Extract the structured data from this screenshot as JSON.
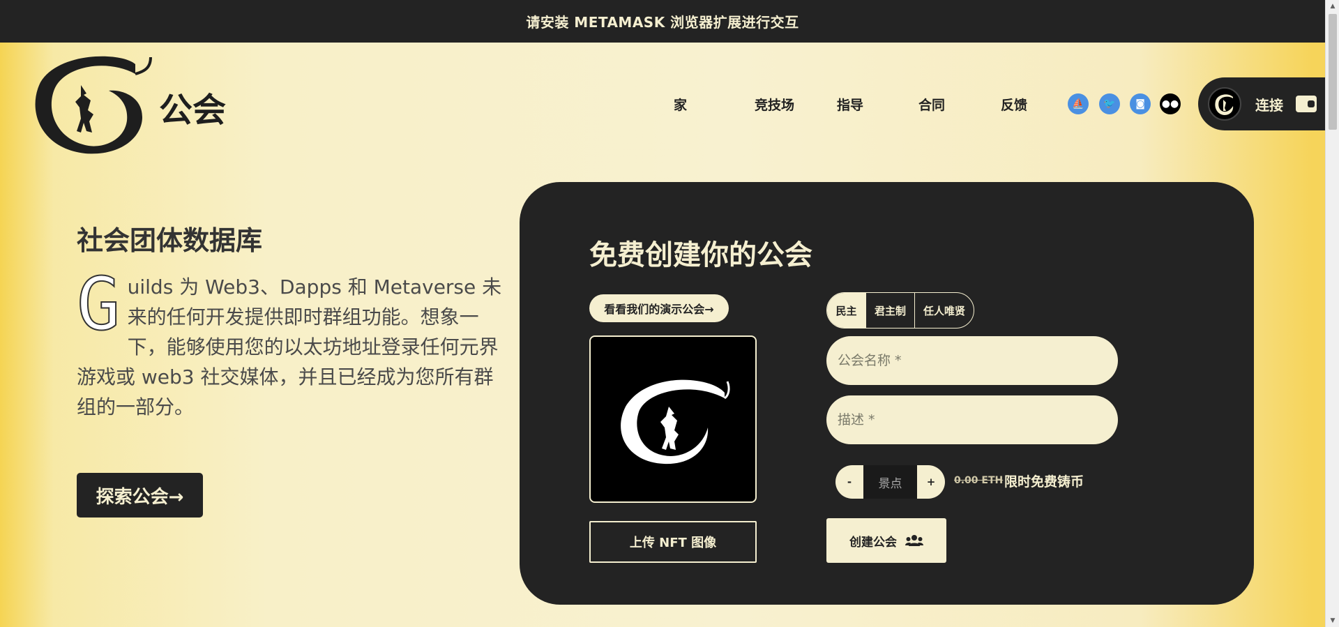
{
  "banner": {
    "text": "请安装 METAMASK 浏览器扩展进行交互"
  },
  "brand": {
    "name": "公会"
  },
  "nav": {
    "items": [
      {
        "label": "家"
      },
      {
        "label": "竞技场"
      },
      {
        "label": "指导"
      },
      {
        "label": "合同"
      },
      {
        "label": "反馈"
      }
    ],
    "socials": [
      {
        "icon": "opensea-icon",
        "color": "#4a90e2"
      },
      {
        "icon": "twitter-icon",
        "color": "#4a90e2"
      },
      {
        "icon": "discord-icon",
        "color": "#4a90e2"
      },
      {
        "icon": "medium-icon",
        "color": "#000000"
      }
    ],
    "connect_label": "连接"
  },
  "hero": {
    "title": "社会团体数据库",
    "dropcap": "G",
    "body": "uilds 为 Web3、Dapps 和 Metaverse 未来的任何开发提供即时群组功能。想象一下，能够使用您的以太坊地址登录任何元界游戏或 web3 社交媒体，并且已经成为您所有群组的一部分。",
    "explore_label": "探索公会→"
  },
  "form": {
    "title": "免费创建你的公会",
    "demo_label": "看看我们的演示公会→",
    "upload_label": "上传 NFT 图像",
    "governance": [
      {
        "label": "民主",
        "active": true
      },
      {
        "label": "君主制",
        "active": false
      },
      {
        "label": "任人唯贤",
        "active": false
      }
    ],
    "name_placeholder": "公会名称 *",
    "description_placeholder": "描述 *",
    "stepper": {
      "minus": "-",
      "plus": "+",
      "value_placeholder": "景点"
    },
    "price_old": "0.00 ETH",
    "price_note": "限时免费铸币",
    "create_label": "创建公会"
  },
  "colors": {
    "dark": "#232323",
    "cream": "#f5efd0",
    "accent_blue": "#4a90e2"
  }
}
